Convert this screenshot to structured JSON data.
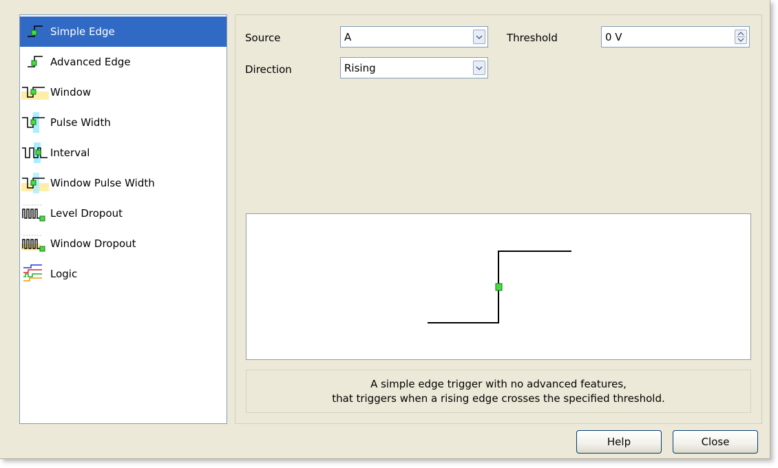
{
  "trigger_types": [
    {
      "label": "Simple Edge",
      "icon": "simple-edge-icon",
      "selected": true
    },
    {
      "label": "Advanced Edge",
      "icon": "advanced-edge-icon",
      "selected": false
    },
    {
      "label": "Window",
      "icon": "window-icon",
      "selected": false
    },
    {
      "label": "Pulse Width",
      "icon": "pulse-width-icon",
      "selected": false
    },
    {
      "label": "Interval",
      "icon": "interval-icon",
      "selected": false
    },
    {
      "label": "Window Pulse Width",
      "icon": "window-pulse-width-icon",
      "selected": false
    },
    {
      "label": "Level Dropout",
      "icon": "level-dropout-icon",
      "selected": false
    },
    {
      "label": "Window Dropout",
      "icon": "window-dropout-icon",
      "selected": false
    },
    {
      "label": "Logic",
      "icon": "logic-icon",
      "selected": false
    }
  ],
  "fields": {
    "source_label": "Source",
    "source_value": "A",
    "direction_label": "Direction",
    "direction_value": "Rising",
    "threshold_label": "Threshold",
    "threshold_value": "0 V"
  },
  "description": {
    "line1": "A simple edge trigger with no advanced features,",
    "line2": "that triggers when a rising edge crosses the specified threshold."
  },
  "buttons": {
    "help": "Help",
    "close": "Close"
  },
  "colors": {
    "selection": "#316ac5",
    "trigger_point": "#44dd44",
    "window_band": "#ffeeaa",
    "pulse_band": "#aaeeff"
  }
}
